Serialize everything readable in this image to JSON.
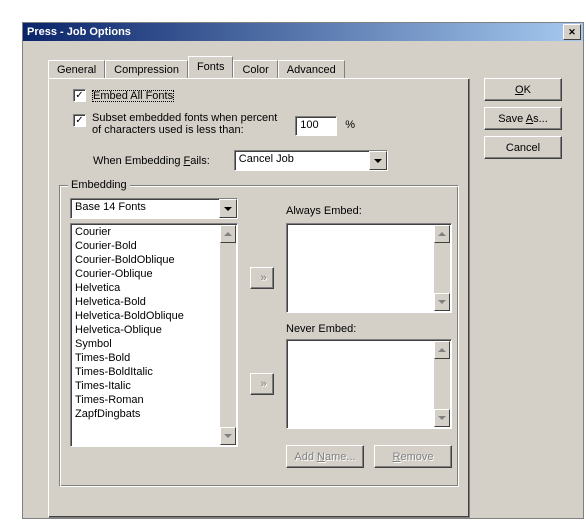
{
  "window": {
    "title": "Press - Job Options"
  },
  "tabs": {
    "general": "General",
    "compression": "Compression",
    "fonts": "Fonts",
    "color": "Color",
    "advanced": "Advanced"
  },
  "checks": {
    "embed_all_label": "Embed All Fonts",
    "embed_all_checked": "✓",
    "subset_label_1": "Subset embedded fonts when percent",
    "subset_label_2": "of characters used is less than:",
    "subset_checked": "✓",
    "subset_value": "100",
    "subset_pct": "%"
  },
  "fail": {
    "label_pre": "When Embedding ",
    "label_u": "F",
    "label_post": "ails:",
    "value": "Cancel Job"
  },
  "embedding": {
    "legend": "Embedding",
    "source_value": "Base 14 Fonts",
    "fonts": [
      "Courier",
      "Courier-Bold",
      "Courier-BoldOblique",
      "Courier-Oblique",
      "Helvetica",
      "Helvetica-Bold",
      "Helvetica-BoldOblique",
      "Helvetica-Oblique",
      "Symbol",
      "Times-Bold",
      "Times-BoldItalic",
      "Times-Italic",
      "Times-Roman",
      "ZapfDingbats"
    ],
    "always_label": "Always Embed:",
    "never_label": "Never Embed:",
    "move_glyph": "»",
    "add_name_pre": "Add ",
    "add_name_u": "N",
    "add_name_post": "ame...",
    "remove_u": "R",
    "remove_post": "emove"
  },
  "actions": {
    "ok_u": "O",
    "ok_post": "K",
    "saveas_pre": "Save ",
    "saveas_u": "A",
    "saveas_post": "s...",
    "cancel": "Cancel"
  }
}
